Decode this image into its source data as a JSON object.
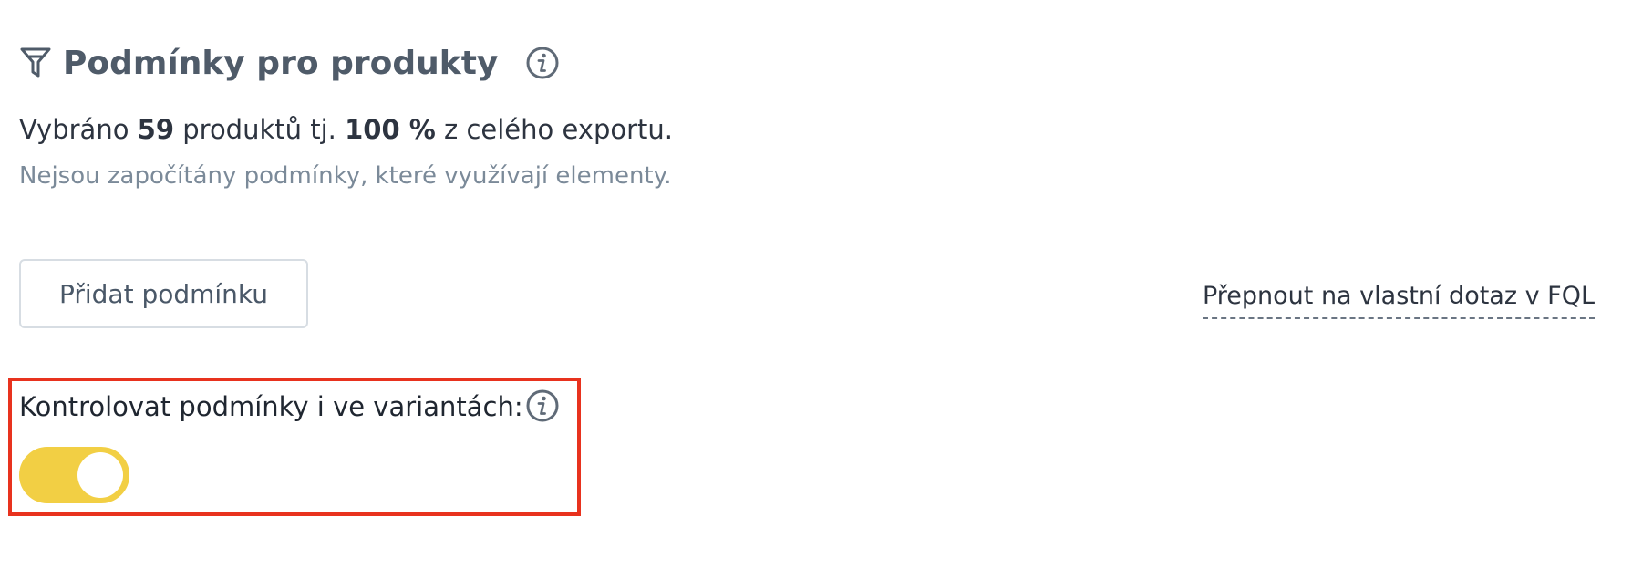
{
  "header": {
    "title": "Podmínky pro produkty",
    "icon": "filter-icon",
    "info_icon": "info-icon"
  },
  "summary": {
    "prefix": "Vybráno",
    "count": "59",
    "middle": "produktů tj.",
    "percent": "100 %",
    "suffix": "z celého exportu."
  },
  "note": "Nejsou započítány podmínky, které využívají elementy.",
  "actions": {
    "add_condition_label": "Přidat podmínku",
    "switch_fql_label": "Přepnout na vlastní dotaz v FQL"
  },
  "variants": {
    "label": "Kontrolovat podmínky i ve variantách:",
    "info_icon": "info-icon",
    "toggle_on": true
  },
  "colors": {
    "heading": "#4f5b69",
    "text": "#2d3440",
    "muted": "#7b8a99",
    "toggle_accent": "#f2cf44",
    "highlight_border": "#e8321e",
    "button_border": "#d7dde3"
  }
}
